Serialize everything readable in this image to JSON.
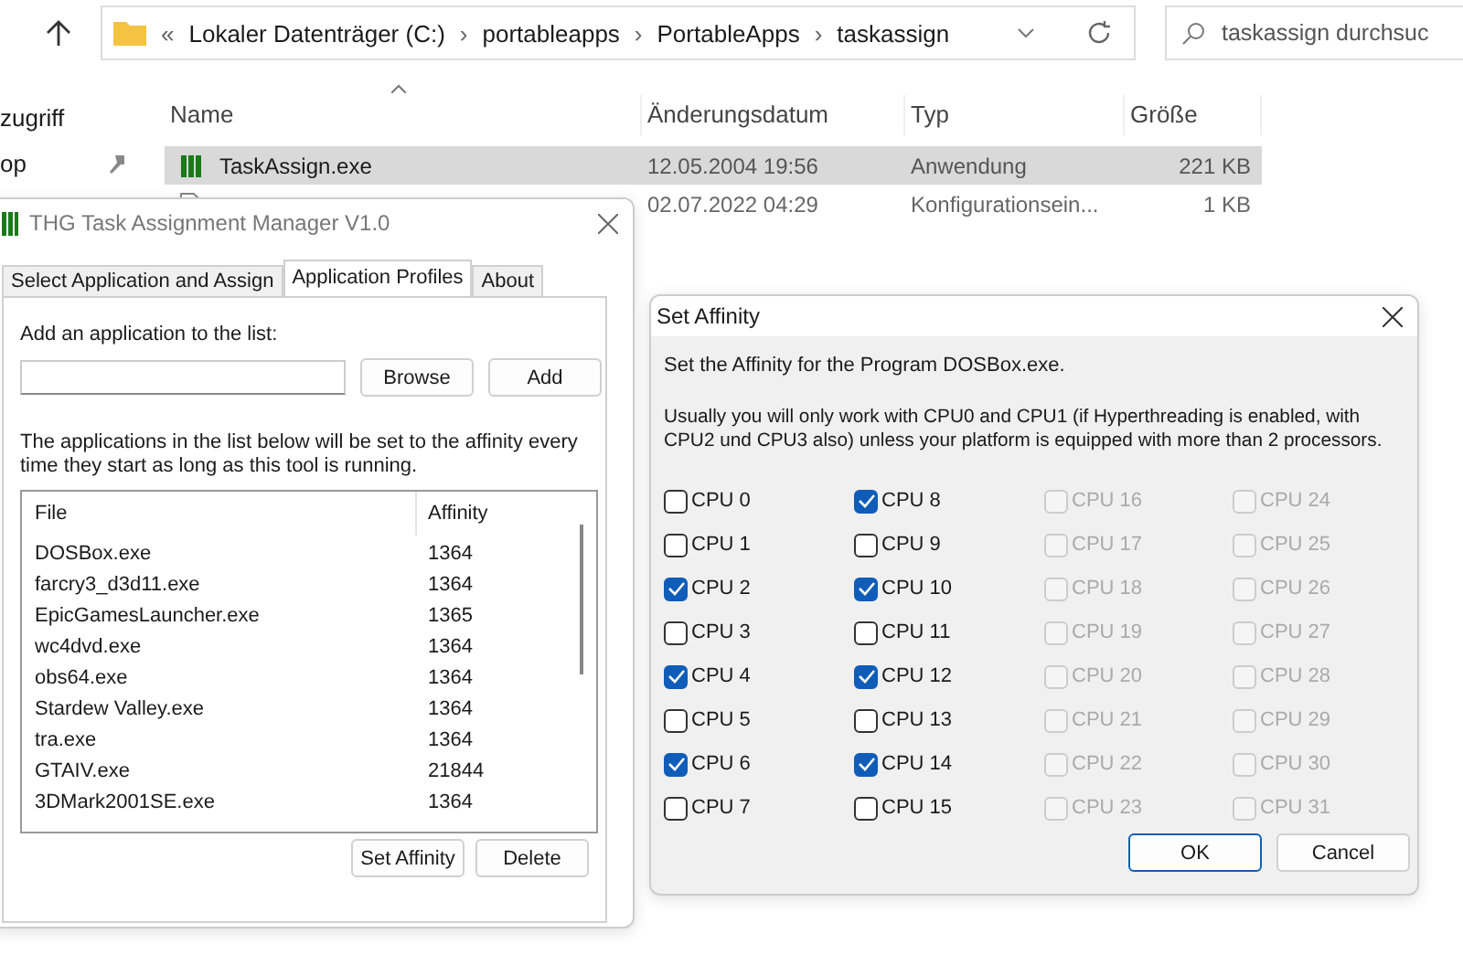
{
  "explorer": {
    "path": [
      {
        "separator": "«",
        "label": "Lokaler Datenträger (C:)"
      },
      {
        "separator": "›",
        "label": "portableapps"
      },
      {
        "separator": "›",
        "label": "PortableApps"
      },
      {
        "separator": "›",
        "label": "taskassign"
      }
    ],
    "search": {
      "placeholder": "taskassign durchsuc"
    },
    "nav_items": [
      {
        "label": "zugriff",
        "pinned": false
      },
      {
        "label": "op",
        "pinned": true
      }
    ],
    "columns": [
      "Name",
      "Änderungsdatum",
      "Typ",
      "Größe"
    ],
    "files": [
      {
        "kind": "app",
        "name": "TaskAssign.exe",
        "date": "12.05.2004 19:56",
        "type": "Anwendung",
        "size": "221 KB",
        "selected": true
      },
      {
        "kind": "doc",
        "date": "02.07.2022 04:29",
        "type": "Konfigurationsein...",
        "size": "1 KB",
        "selected": false
      }
    ]
  },
  "manager": {
    "title": "THG Task Assignment Manager V1.0",
    "tabs": [
      {
        "label": "Select Application and Assign",
        "selected": false
      },
      {
        "label": "Application Profiles",
        "selected": true
      },
      {
        "label": "About",
        "selected": false
      }
    ],
    "add_label": "Add an application to the list:",
    "buttons_top": [
      "Browse",
      "Add"
    ],
    "note": "The applications in the list below will be set to the affinity every time they start as long as this tool is running.",
    "list": {
      "columns": [
        "File",
        "Affinity"
      ],
      "rows": [
        {
          "file": "DOSBox.exe",
          "affinity": "1364"
        },
        {
          "file": "farcry3_d3d11.exe",
          "affinity": "1364"
        },
        {
          "file": "EpicGamesLauncher.exe",
          "affinity": "1365"
        },
        {
          "file": "wc4dvd.exe",
          "affinity": "1364"
        },
        {
          "file": "obs64.exe",
          "affinity": "1364"
        },
        {
          "file": "Stardew Valley.exe",
          "affinity": "1364"
        },
        {
          "file": "tra.exe",
          "affinity": "1364"
        },
        {
          "file": "GTAIV.exe",
          "affinity": "21844"
        },
        {
          "file": "3DMark2001SE.exe",
          "affinity": "1364"
        }
      ]
    },
    "buttons_bottom": [
      "Set Affinity",
      "Delete"
    ]
  },
  "affinity_dialog": {
    "title": "Set Affinity",
    "intro": "Set the Affinity for the Program DOSBox.exe.",
    "note": "Usually you will only work with CPU0 and CPU1 (if Hyperthreading is enabled, with CPU2 und CPU3 also) unless your platform is equipped with more than 2 processors.",
    "cpus": [
      {
        "label": "CPU 0",
        "checked": false,
        "disabled": false
      },
      {
        "label": "CPU 1",
        "checked": false,
        "disabled": false
      },
      {
        "label": "CPU 2",
        "checked": true,
        "disabled": false
      },
      {
        "label": "CPU 3",
        "checked": false,
        "disabled": false
      },
      {
        "label": "CPU 4",
        "checked": true,
        "disabled": false
      },
      {
        "label": "CPU 5",
        "checked": false,
        "disabled": false
      },
      {
        "label": "CPU 6",
        "checked": true,
        "disabled": false
      },
      {
        "label": "CPU 7",
        "checked": false,
        "disabled": false
      },
      {
        "label": "CPU 8",
        "checked": true,
        "disabled": false
      },
      {
        "label": "CPU 9",
        "checked": false,
        "disabled": false
      },
      {
        "label": "CPU 10",
        "checked": true,
        "disabled": false
      },
      {
        "label": "CPU 11",
        "checked": false,
        "disabled": false
      },
      {
        "label": "CPU 12",
        "checked": true,
        "disabled": false
      },
      {
        "label": "CPU 13",
        "checked": false,
        "disabled": false
      },
      {
        "label": "CPU 14",
        "checked": true,
        "disabled": false
      },
      {
        "label": "CPU 15",
        "checked": false,
        "disabled": false
      },
      {
        "label": "CPU 16",
        "checked": false,
        "disabled": true
      },
      {
        "label": "CPU 17",
        "checked": false,
        "disabled": true
      },
      {
        "label": "CPU 18",
        "checked": false,
        "disabled": true
      },
      {
        "label": "CPU 19",
        "checked": false,
        "disabled": true
      },
      {
        "label": "CPU 20",
        "checked": false,
        "disabled": true
      },
      {
        "label": "CPU 21",
        "checked": false,
        "disabled": true
      },
      {
        "label": "CPU 22",
        "checked": false,
        "disabled": true
      },
      {
        "label": "CPU 23",
        "checked": false,
        "disabled": true
      },
      {
        "label": "CPU 24",
        "checked": false,
        "disabled": true
      },
      {
        "label": "CPU 25",
        "checked": false,
        "disabled": true
      },
      {
        "label": "CPU 26",
        "checked": false,
        "disabled": true
      },
      {
        "label": "CPU 27",
        "checked": false,
        "disabled": true
      },
      {
        "label": "CPU 28",
        "checked": false,
        "disabled": true
      },
      {
        "label": "CPU 29",
        "checked": false,
        "disabled": true
      },
      {
        "label": "CPU 30",
        "checked": false,
        "disabled": true
      },
      {
        "label": "CPU 31",
        "checked": false,
        "disabled": true
      }
    ],
    "buttons": [
      {
        "label": "OK",
        "default": true
      },
      {
        "label": "Cancel",
        "default": false
      }
    ]
  }
}
